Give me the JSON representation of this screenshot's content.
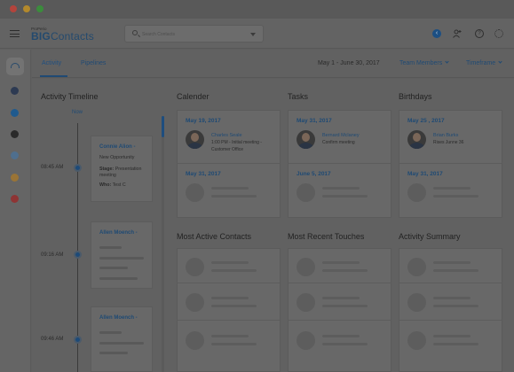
{
  "window": {
    "controls": [
      "close",
      "minimize",
      "maximize"
    ]
  },
  "header": {
    "logo_small": "ProPerio",
    "logo_big": "BIG",
    "logo_rest": "Contacts",
    "search_placeholder": "Search Contacts",
    "notification_badge": "‹"
  },
  "subnav": {
    "tabs": [
      {
        "label": "Activity"
      },
      {
        "label": "Pipelines"
      }
    ],
    "date_range": "May 1 - June 30, 2017",
    "team_filter": "Team Members",
    "timeframe_filter": "Timeframe"
  },
  "timeline": {
    "title": "Activity Timeline",
    "now_label": "Now",
    "items": [
      {
        "time": "08:45 AM",
        "name": "Connie Alion -",
        "line1": "New Opportunity",
        "stage_label": "Stage:",
        "stage_value": "Presentation meeting",
        "who_label": "Who:",
        "who_value": "Test C"
      },
      {
        "time": "09:16 AM",
        "name": "Allen Moench -"
      },
      {
        "time": "09:46 AM",
        "name": "Allen Moench -"
      }
    ]
  },
  "calendar": {
    "title": "Calender",
    "date1": "May 19, 2017",
    "person": "Charles Seale",
    "detail1": "1:00 PM - Initial meeting -",
    "detail2": "Customer Office",
    "date2": "May 31, 2017"
  },
  "tasks": {
    "title": "Tasks",
    "date1": "May 31, 2017",
    "person": "Bernard Mclaney",
    "detail1": "Confirm meeting",
    "date2": "June 5, 2017"
  },
  "birthdays": {
    "title": "Birthdays",
    "date1": "May 25 , 2017",
    "person": "Brian Burks",
    "detail1": "Rises Junne 36",
    "date2": "May 31, 2017"
  },
  "sections": {
    "most_active": "Most Active Contacts",
    "most_recent": "Most Recent Touches",
    "summary": "Activity Summary"
  },
  "colors": {
    "accent": "#1f4a74",
    "rail_dots": [
      "#2d3a52",
      "#1f5a8e",
      "#2a2a2a",
      "#4f6f8e",
      "#9a7436",
      "#8e3434"
    ]
  }
}
